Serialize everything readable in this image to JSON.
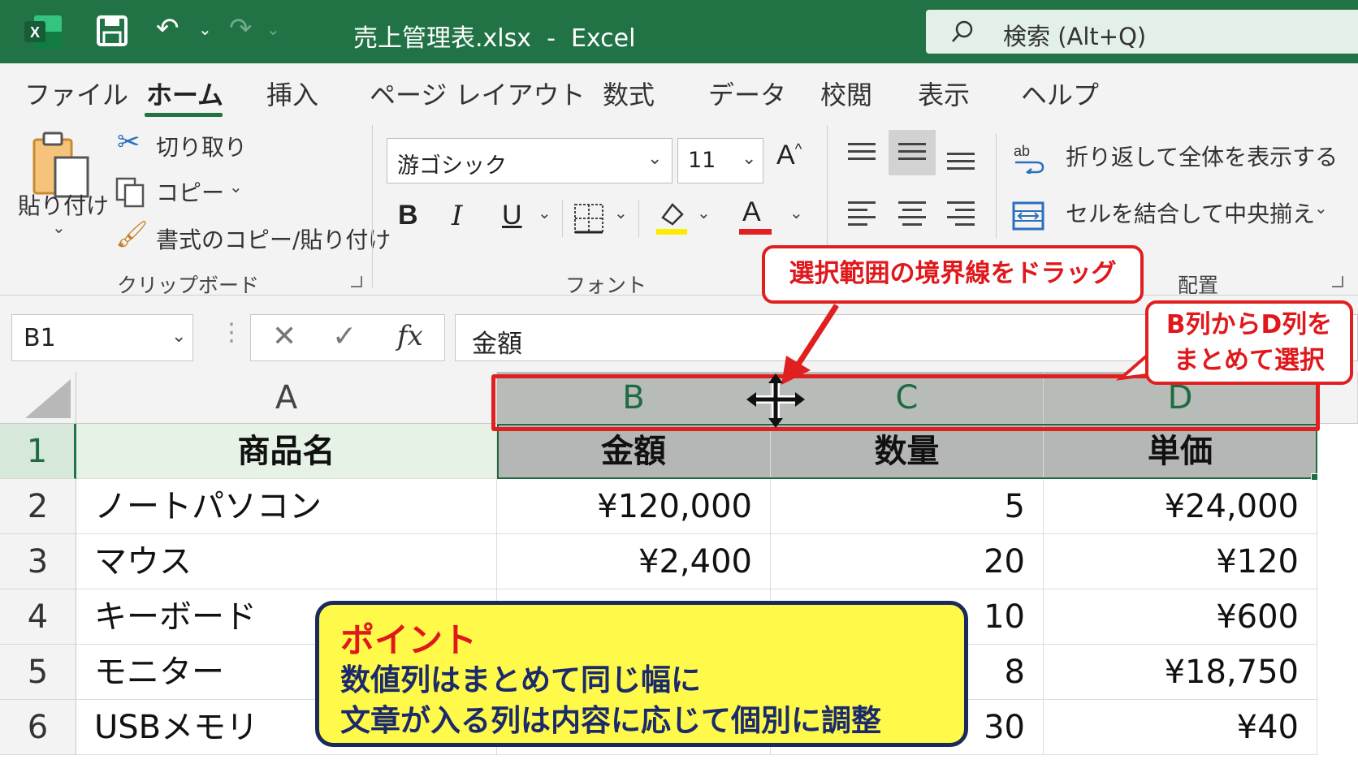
{
  "titlebar": {
    "app_icon_letter": "X",
    "document_title": "売上管理表.xlsx  -  Excel",
    "search_placeholder": "検索 (Alt+Q)"
  },
  "ribbon_tabs": [
    "ファイル",
    "ホーム",
    "挿入",
    "ページ レイアウト",
    "数式",
    "データ",
    "校閲",
    "表示",
    "ヘルプ"
  ],
  "active_tab": "ホーム",
  "clipboard": {
    "paste_label": "貼り付け",
    "cut_label": "切り取り",
    "copy_label": "コピー",
    "format_painter_label": "書式のコピー/貼り付け",
    "group_label": "クリップボード"
  },
  "font": {
    "font_name": "游ゴシック",
    "font_size": "11",
    "grow_label": "A",
    "bold_label": "B",
    "italic_label": "I",
    "underline_label": "U",
    "font_color_label": "A",
    "group_label": "フォント"
  },
  "alignment": {
    "wrap_text_label": "折り返して全体を表示する",
    "merge_center_label": "セルを結合して中央揃え",
    "group_label": "配置"
  },
  "formula_bar": {
    "name_box": "B1",
    "fx_label": "fx",
    "formula_value": "金額"
  },
  "grid": {
    "columns": [
      "A",
      "B",
      "C",
      "D"
    ],
    "rows": [
      {
        "num": "1",
        "cells": [
          "商品名",
          "金額",
          "数量",
          "単価"
        ]
      },
      {
        "num": "2",
        "cells": [
          "ノートパソコン",
          "¥120,000",
          "5",
          "¥24,000"
        ]
      },
      {
        "num": "3",
        "cells": [
          "マウス",
          "¥2,400",
          "20",
          "¥120"
        ]
      },
      {
        "num": "4",
        "cells": [
          "キーボード",
          "",
          "10",
          "¥600"
        ]
      },
      {
        "num": "5",
        "cells": [
          "モニター",
          "",
          "8",
          "¥18,750"
        ]
      },
      {
        "num": "6",
        "cells": [
          "USBメモリ",
          "",
          "30",
          "¥40"
        ]
      }
    ]
  },
  "annotations": {
    "drag_callout": "選択範囲の境界線をドラッグ",
    "select_callout_line1": "B列からD列を",
    "select_callout_line2": "まとめて選択",
    "point_title": "ポイント",
    "point_line1": "数値列はまとめて同じ幅に",
    "point_line2": "文章が入る列は内容に応じて個別に調整"
  },
  "colors": {
    "excel_green": "#217346",
    "annotation_red": "#e02020",
    "point_yellow": "#fff94a",
    "point_navy": "#1a2a5a"
  }
}
